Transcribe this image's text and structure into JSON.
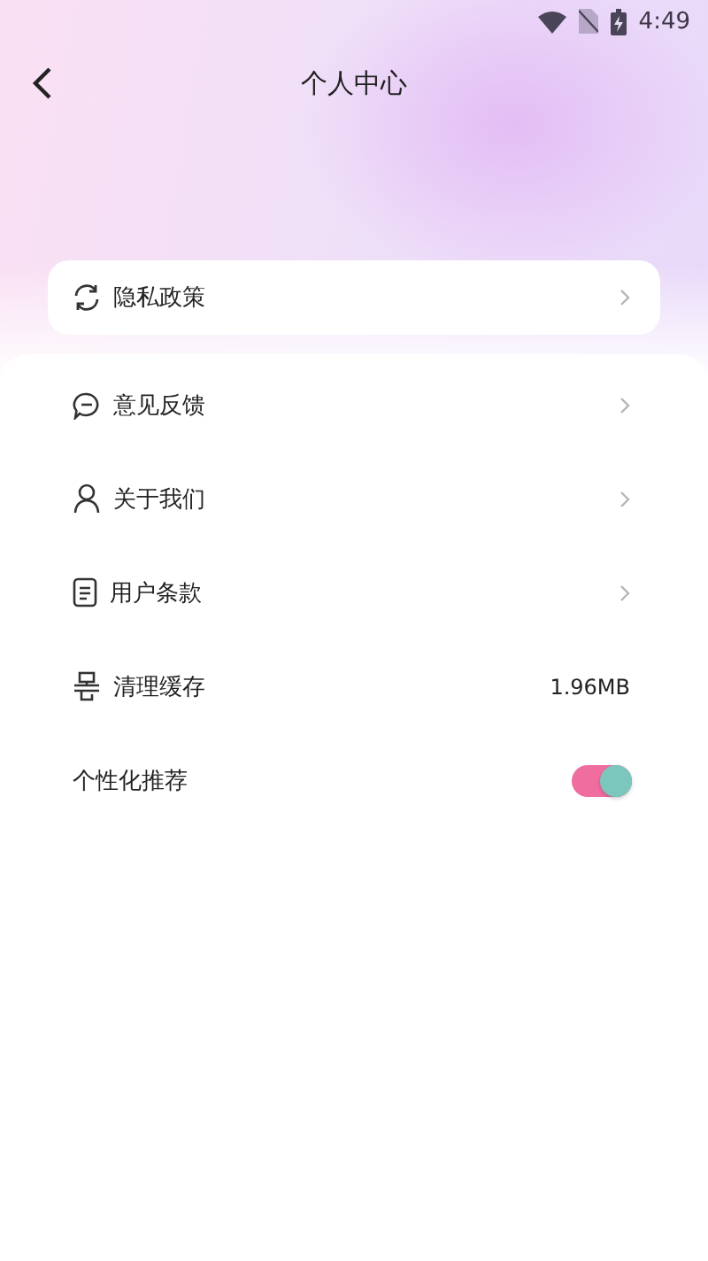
{
  "status_bar": {
    "time": "4:49"
  },
  "header": {
    "title": "个人中心"
  },
  "featured_item": {
    "label": "隐私政策",
    "kind": "link"
  },
  "items": [
    {
      "label": "意见反馈",
      "kind": "link"
    },
    {
      "label": "关于我们",
      "kind": "link"
    },
    {
      "label": "用户条款",
      "kind": "link"
    },
    {
      "label": "清理缓存",
      "kind": "value",
      "value": "1.96MB"
    },
    {
      "label": "个性化推荐",
      "kind": "toggle",
      "on": true
    }
  ]
}
